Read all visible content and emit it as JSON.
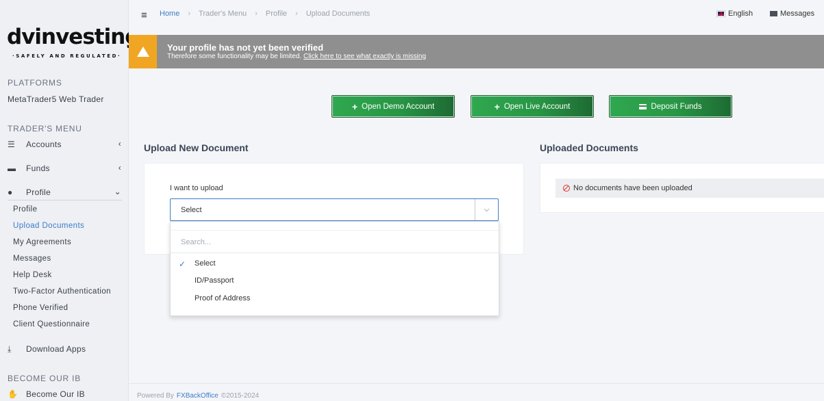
{
  "logo": {
    "text": "dvinvesting",
    "tagline": "·SAFELY AND REGULATED·"
  },
  "sidebar": {
    "platforms_header": "PLATFORMS",
    "platform_link": "MetaTrader5 Web Trader",
    "traders_menu_header": "TRADER'S MENU",
    "items": [
      {
        "label": "Accounts",
        "icon": "list-icon",
        "chevron": "‹"
      },
      {
        "label": "Funds",
        "icon": "wallet-icon",
        "chevron": "‹"
      },
      {
        "label": "Profile",
        "icon": "user-icon",
        "chevron": "⌄"
      }
    ],
    "profile_sub": [
      {
        "label": "Profile"
      },
      {
        "label": "Upload Documents",
        "active": true
      },
      {
        "label": "My Agreements"
      },
      {
        "label": "Messages"
      },
      {
        "label": "Help Desk"
      },
      {
        "label": "Two-Factor Authentication"
      },
      {
        "label": "Phone Verified"
      },
      {
        "label": "Client Questionnaire"
      }
    ],
    "download_apps": "Download Apps",
    "ib_header": "BECOME OUR IB",
    "become_ib": "Become Our IB"
  },
  "topbar": {
    "breadcrumb": [
      "Home",
      "Trader's Menu",
      "Profile",
      "Upload Documents"
    ],
    "language": "English",
    "messages": "Messages"
  },
  "banner": {
    "title": "Your profile has not yet been verified",
    "text": "Therefore some functionality may be limited.",
    "link": "Click here to see what exactly is missing",
    "accent": "#f0a623"
  },
  "actions": {
    "open_demo": "Open Demo Account",
    "open_live": "Open Live Account",
    "deposit": "Deposit Funds"
  },
  "upload": {
    "title": "Upload New Document",
    "label": "I want to upload",
    "selected": "Select",
    "search_placeholder": "Search...",
    "options": [
      "Select",
      "ID/Passport",
      "Proof of Address"
    ]
  },
  "uploaded": {
    "title": "Uploaded Documents",
    "empty_text": "No documents have been uploaded"
  },
  "footer": {
    "powered_by": "Powered By",
    "brand": "FXBackOffice",
    "copyright": "©2015-2024"
  }
}
